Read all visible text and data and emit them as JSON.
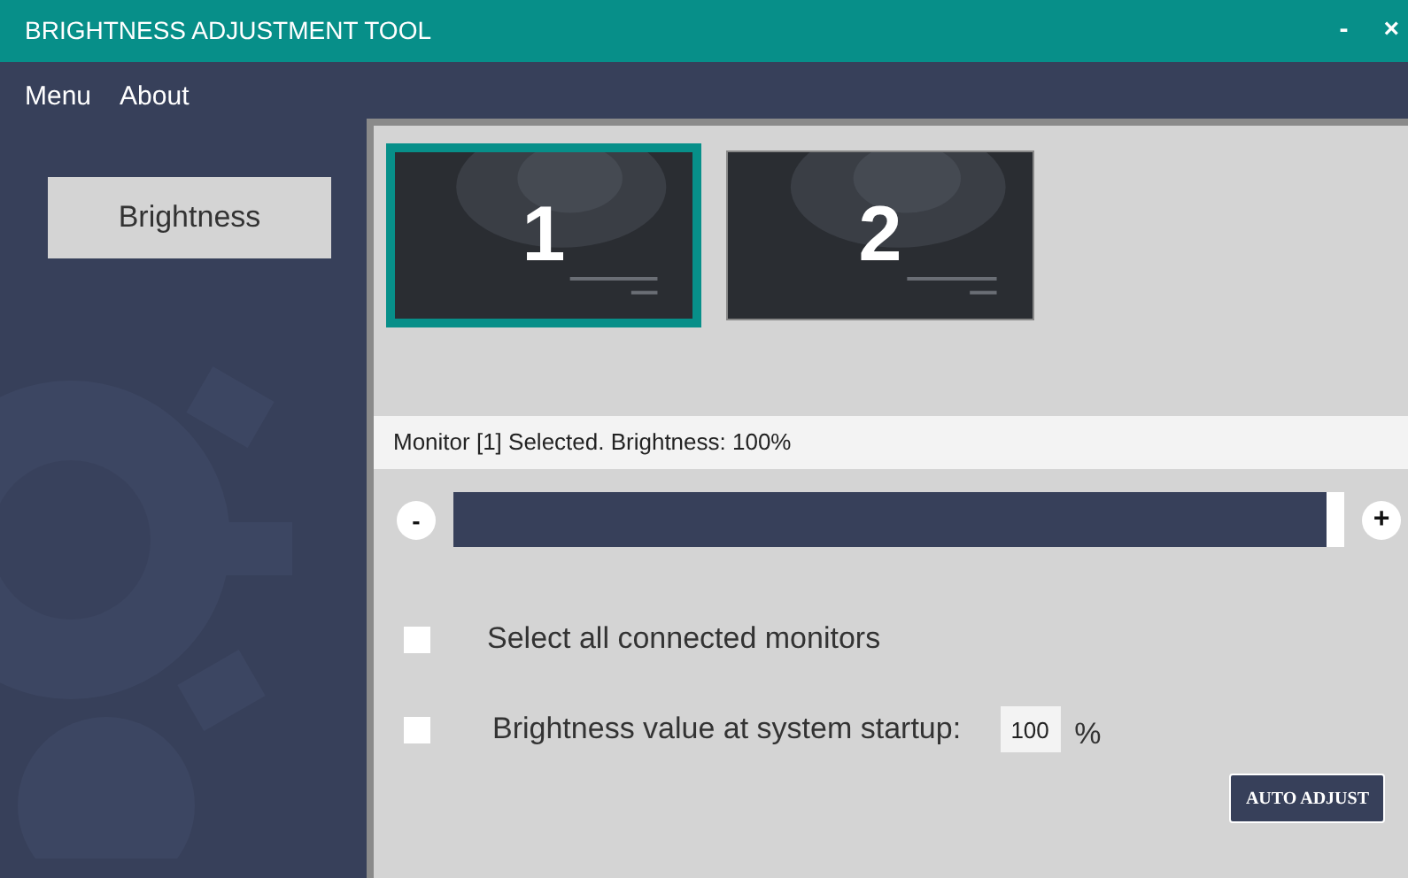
{
  "window": {
    "title": "BRIGHTNESS ADJUSTMENT TOOL",
    "controls": [
      "-",
      "×"
    ]
  },
  "menu": [
    "Menu",
    "About"
  ],
  "sidebar": {
    "items": [
      {
        "label": "Brightness",
        "selected": true
      }
    ]
  },
  "monitors": [
    {
      "label": "1",
      "selected": true
    },
    {
      "label": "2",
      "selected": false
    }
  ],
  "status": "Monitor [1] Selected. Brightness: 100%",
  "slider": {
    "minus": "-",
    "plus": "+",
    "level": 0.98
  },
  "options": [
    {
      "kind": "checkbox",
      "label": "Select all connected monitors",
      "checked": false
    },
    {
      "kind": "value",
      "label": "Brightness value at system startup:",
      "checked": false,
      "value": "100",
      "unit": "%"
    }
  ],
  "button": "AUTO ADJUST"
}
